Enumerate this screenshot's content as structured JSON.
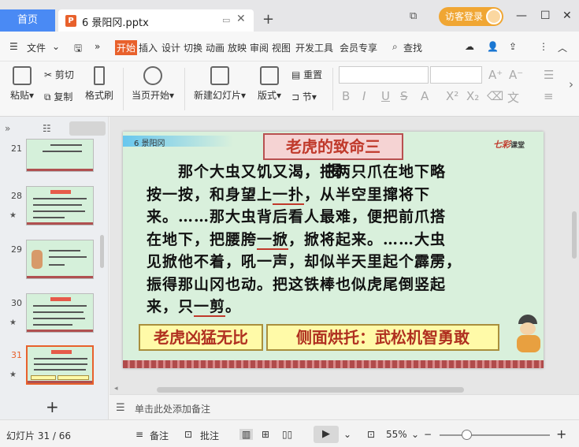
{
  "titlebar": {
    "home_tab": "首页",
    "doc_icon_letter": "P",
    "doc_name": "6 景阳冈.pptx",
    "tab_window_icon": "window-icon",
    "tab_close": "✕",
    "add_tab": "+",
    "page_count_icon": "1",
    "login_label": "访客登录",
    "minimize": "—",
    "maximize": "☐",
    "close": "✕"
  },
  "menubar": {
    "hamburger": "☰",
    "file_menu": "文件",
    "menu_items": [
      "开始",
      "插入",
      "设计",
      "切换",
      "动画",
      "放映",
      "审阅",
      "视图",
      "开发工具",
      "会员专享"
    ],
    "active_index": 0,
    "search_label": "查找"
  },
  "ribbon": {
    "paste": "粘贴",
    "cut": "剪切",
    "copy": "复制",
    "format_painter": "格式刷",
    "start_from_current": "当页开始",
    "new_slide": "新建幻灯片",
    "layout": "版式",
    "reset": "重置",
    "section": "节",
    "font_controls": [
      "B",
      "I",
      "U",
      "S",
      "A",
      "X²",
      "X₂"
    ]
  },
  "slides_panel": {
    "thumbnails": [
      {
        "num": "21",
        "star": false,
        "active": false
      },
      {
        "num": "28",
        "star": true,
        "active": false
      },
      {
        "num": "29",
        "star": false,
        "active": false
      },
      {
        "num": "30",
        "star": true,
        "active": false
      },
      {
        "num": "31",
        "star": true,
        "active": true
      }
    ],
    "add_slide": "+"
  },
  "slide": {
    "header_label": "6 景阳冈",
    "title": "老虎的致命三",
    "logo_main": "七彩",
    "logo_sub": "课堂",
    "floating_char": "揭",
    "body_lines": [
      {
        "pre": "　　那个大虫又饥又渴，把两只爪在地下略",
        "ul": "",
        "post": ""
      },
      {
        "pre": "按一按，和身望上",
        "ul": "一扑",
        "post": "，从半空里撺将下"
      },
      {
        "pre": "来。……那大虫背后看人最难，便把前爪搭",
        "ul": "",
        "post": ""
      },
      {
        "pre": "在地下，把腰胯",
        "ul": "一掀",
        "post": "，掀将起来。……大虫"
      },
      {
        "pre": "见掀他不着，吼一声，却似半天里起个霹雳，",
        "ul": "",
        "post": ""
      },
      {
        "pre": "振得那山冈也动。把这铁棒也似虎尾倒竖起",
        "ul": "",
        "post": ""
      },
      {
        "pre": "来，只",
        "ul": "一剪",
        "post": "。"
      }
    ],
    "box_left": "老虎凶猛无比",
    "box_right": "侧面烘托：武松机智勇敢"
  },
  "notes": {
    "placeholder": "单击此处添加备注"
  },
  "statusbar": {
    "slide_counter": "幻灯片 31 / 66",
    "notes_btn": "备注",
    "comment_btn": "批注",
    "zoom": "55%",
    "zoom_minus": "−",
    "zoom_plus": "+",
    "zoom_level": 0.55
  }
}
